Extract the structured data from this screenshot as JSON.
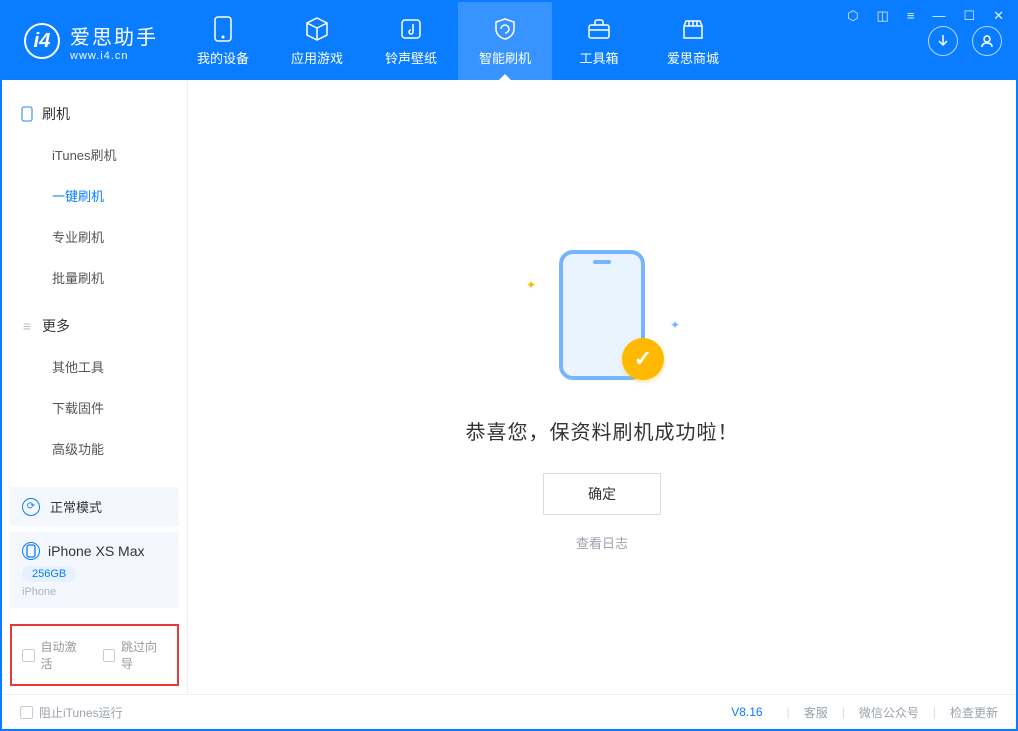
{
  "app": {
    "name": "爱思助手",
    "site": "www.i4.cn"
  },
  "nav": {
    "items": [
      {
        "label": "我的设备"
      },
      {
        "label": "应用游戏"
      },
      {
        "label": "铃声壁纸"
      },
      {
        "label": "智能刷机"
      },
      {
        "label": "工具箱"
      },
      {
        "label": "爱思商城"
      }
    ]
  },
  "sidebar": {
    "cat1": {
      "label": "刷机"
    },
    "subs1": [
      {
        "label": "iTunes刷机"
      },
      {
        "label": "一键刷机"
      },
      {
        "label": "专业刷机"
      },
      {
        "label": "批量刷机"
      }
    ],
    "cat2": {
      "label": "更多"
    },
    "subs2": [
      {
        "label": "其他工具"
      },
      {
        "label": "下载固件"
      },
      {
        "label": "高级功能"
      }
    ],
    "mode": "正常模式",
    "device": {
      "name": "iPhone XS Max",
      "storage": "256GB",
      "type": "iPhone"
    },
    "opts": {
      "autoActivate": "自动激活",
      "skipGuide": "跳过向导"
    }
  },
  "main": {
    "successText": "恭喜您，保资料刷机成功啦！",
    "okLabel": "确定",
    "logLink": "查看日志"
  },
  "footer": {
    "blockItunes": "阻止iTunes运行",
    "version": "V8.16",
    "links": {
      "support": "客服",
      "wechat": "微信公众号",
      "update": "检查更新"
    }
  }
}
